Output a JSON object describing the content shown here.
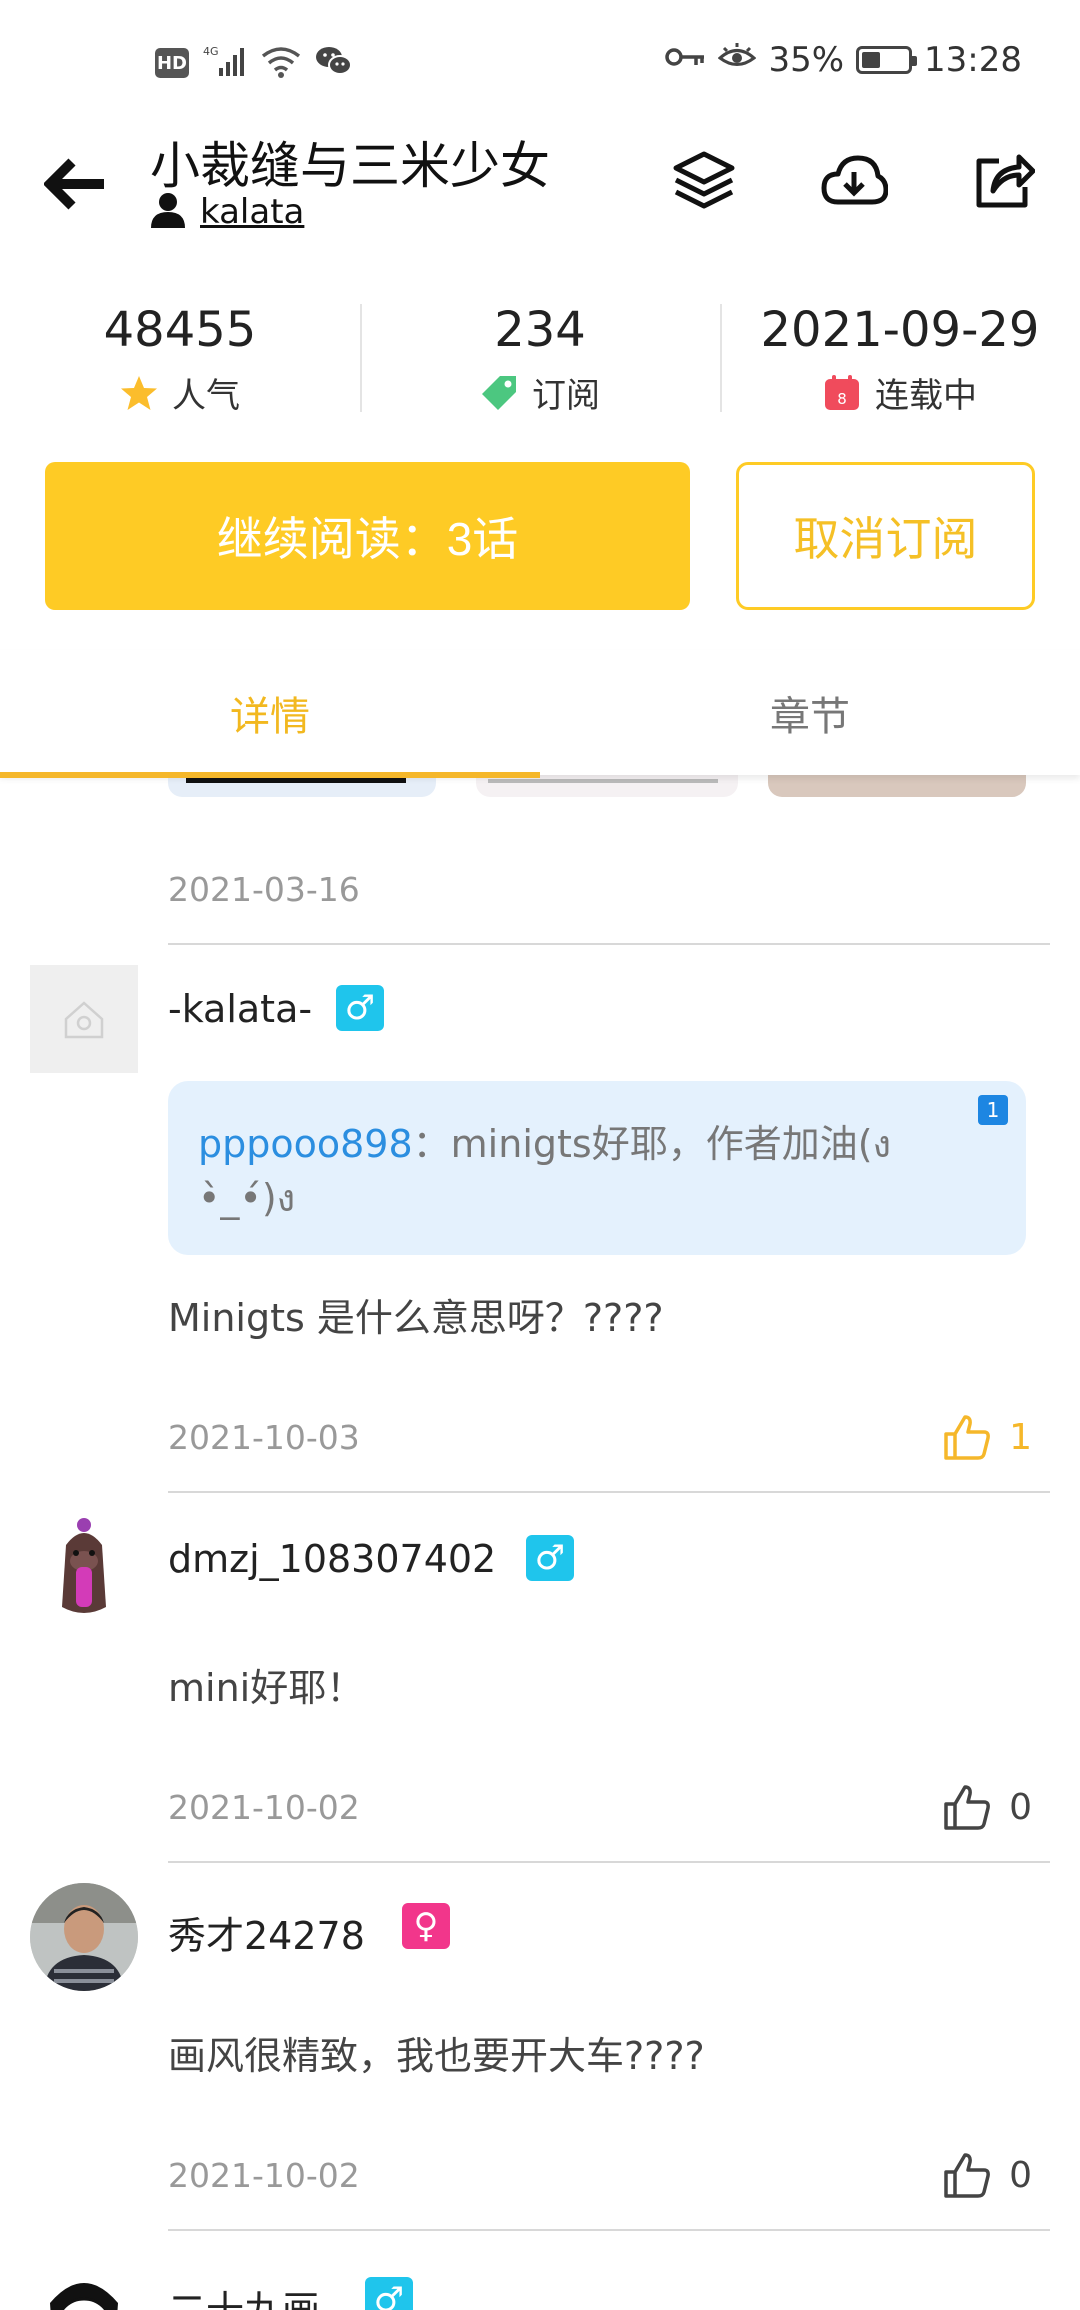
{
  "status_bar": {
    "left_badge": "HD",
    "network": "4G",
    "battery_percent": "35%",
    "battery_level": 0.35,
    "time": "13:28"
  },
  "header": {
    "title": "小裁缝与三米少女",
    "author": "kalata"
  },
  "stats": {
    "popularity_value": "48455",
    "popularity_label": "人气",
    "subscribe_value": "234",
    "subscribe_label": "订阅",
    "date_value": "2021-09-29",
    "status_label": "连载中",
    "calendar_day": "8"
  },
  "actions": {
    "continue_label": "继续阅读：3话",
    "unsubscribe_label": "取消订阅"
  },
  "tabs": [
    {
      "label": "详情",
      "active": true
    },
    {
      "label": "章节",
      "active": false
    }
  ],
  "comments": {
    "first_date": "2021-03-16",
    "items": [
      {
        "username": "-kalata-",
        "gender": "male",
        "gender_symbol": "♂",
        "quote_user": "pppooo898",
        "quote_sep": "：",
        "quote_text": "minigts好耶，作者加油(ง",
        "quote_text_line2": "•̀_•́)ง",
        "quote_count": "1",
        "text": "Minigts 是什么意思呀？????",
        "date": "2021-10-03",
        "likes": "1",
        "liked": true
      },
      {
        "username": "dmzj_108307402",
        "gender": "male",
        "gender_symbol": "♂",
        "text": "mini好耶！",
        "date": "2021-10-02",
        "likes": "0",
        "liked": false
      },
      {
        "username": "秀才24278",
        "gender": "female",
        "gender_symbol": "♀",
        "text": "画风很精致，我也要开大车????",
        "date": "2021-10-02",
        "likes": "0",
        "liked": false
      },
      {
        "username": "二十九画",
        "gender": "male",
        "gender_symbol": "♂"
      }
    ]
  },
  "colors": {
    "accent_yellow": "#fecb25",
    "male_badge": "#1fc5ec",
    "female_badge": "#f2368b",
    "quote_bg": "#e4f1fd",
    "quote_user": "#2b8ee0"
  }
}
